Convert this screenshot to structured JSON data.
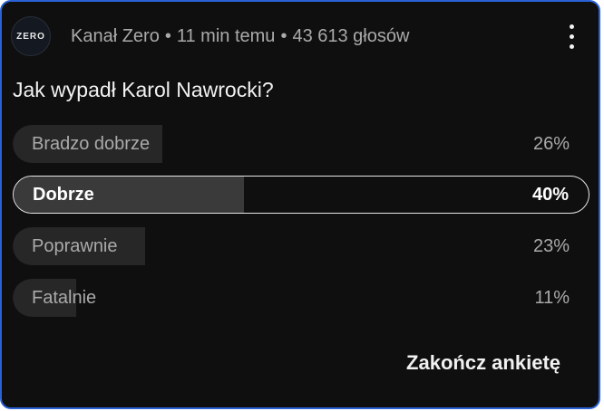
{
  "post": {
    "avatar_text": "ZERO",
    "channel": "Kanał Zero",
    "time": "11 min temu",
    "votes": "43 613 głosów",
    "separator": "•"
  },
  "poll": {
    "question": "Jak wypadł Karol Nawrocki?",
    "options": [
      {
        "label": "Bradzo dobrze",
        "percent": "26%",
        "share": 26,
        "selected": false
      },
      {
        "label": "Dobrze",
        "percent": "40%",
        "share": 40,
        "selected": true
      },
      {
        "label": "Poprawnie",
        "percent": "23%",
        "share": 23,
        "selected": false
      },
      {
        "label": "Fatalnie",
        "percent": "11%",
        "share": 11,
        "selected": false
      }
    ],
    "end_label": "Zakończ ankietę"
  },
  "icons": {
    "menu": "vertical-ellipsis-icon"
  },
  "colors": {
    "background": "#0f0f0f",
    "border_accent": "#2a62d6",
    "text_primary": "#f1f1f1",
    "text_secondary": "#aaaaaa"
  }
}
